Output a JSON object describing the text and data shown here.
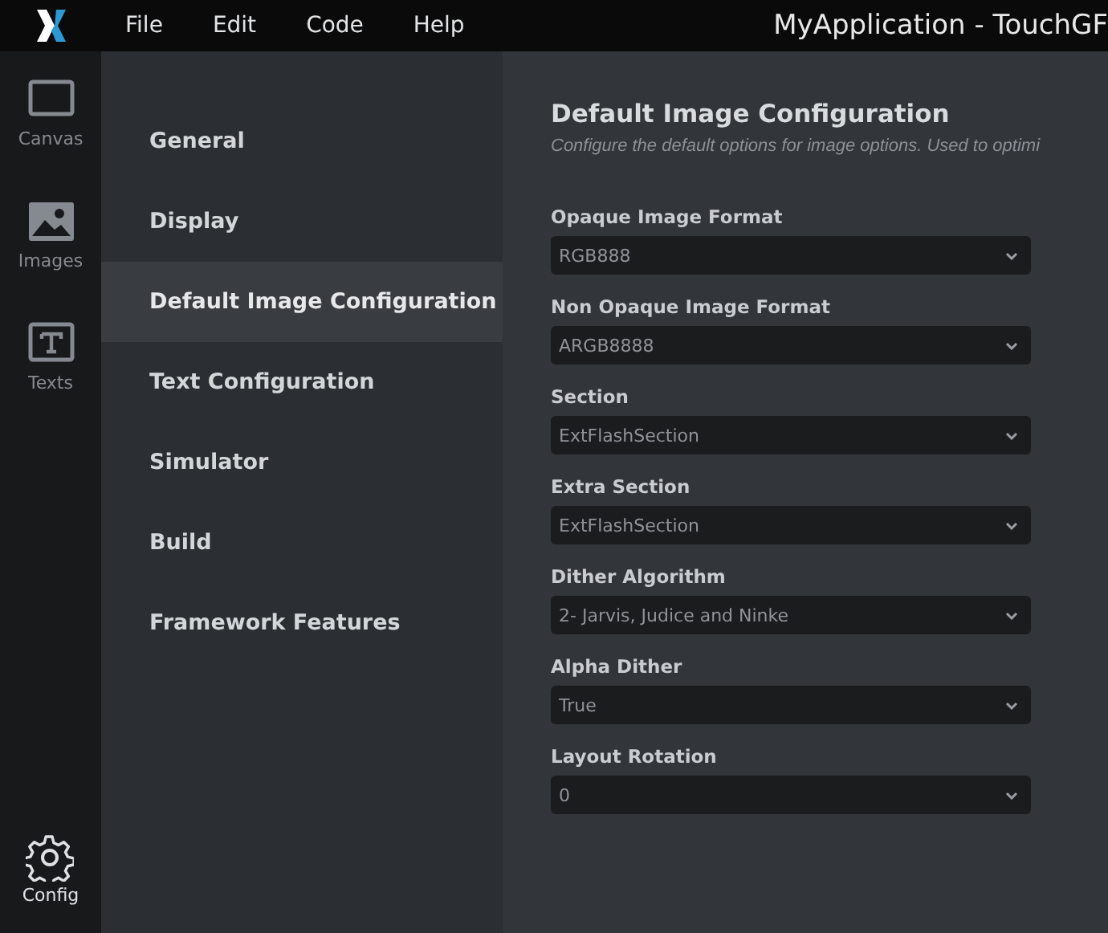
{
  "menu": [
    "File",
    "Edit",
    "Code",
    "Help"
  ],
  "window": {
    "title": "MyApplication - TouchGF"
  },
  "rail": [
    {
      "kind": "canvas",
      "label": "Canvas",
      "selected": false
    },
    {
      "kind": "images",
      "label": "Images",
      "selected": false
    },
    {
      "kind": "texts",
      "label": "Texts",
      "selected": false
    },
    {
      "kind": "config",
      "label": "Config",
      "selected": true
    }
  ],
  "nav": [
    {
      "label": "General",
      "selected": false
    },
    {
      "label": "Display",
      "selected": false
    },
    {
      "label": "Default Image Configuration",
      "selected": true
    },
    {
      "label": "Text Configuration",
      "selected": false
    },
    {
      "label": "Simulator",
      "selected": false
    },
    {
      "label": "Build",
      "selected": false
    },
    {
      "label": "Framework Features",
      "selected": false
    }
  ],
  "content": {
    "title": "Default Image Configuration",
    "description": "Configure the default options for image options. Used to optimi",
    "fields": [
      {
        "label": "Opaque Image Format",
        "value": "RGB888"
      },
      {
        "label": "Non Opaque Image Format",
        "value": "ARGB8888"
      },
      {
        "label": "Section",
        "value": "ExtFlashSection"
      },
      {
        "label": "Extra Section",
        "value": "ExtFlashSection"
      },
      {
        "label": "Dither Algorithm",
        "value": "2- Jarvis, Judice and Ninke"
      },
      {
        "label": "Alpha Dither",
        "value": "True"
      },
      {
        "label": "Layout Rotation",
        "value": "0"
      }
    ]
  }
}
